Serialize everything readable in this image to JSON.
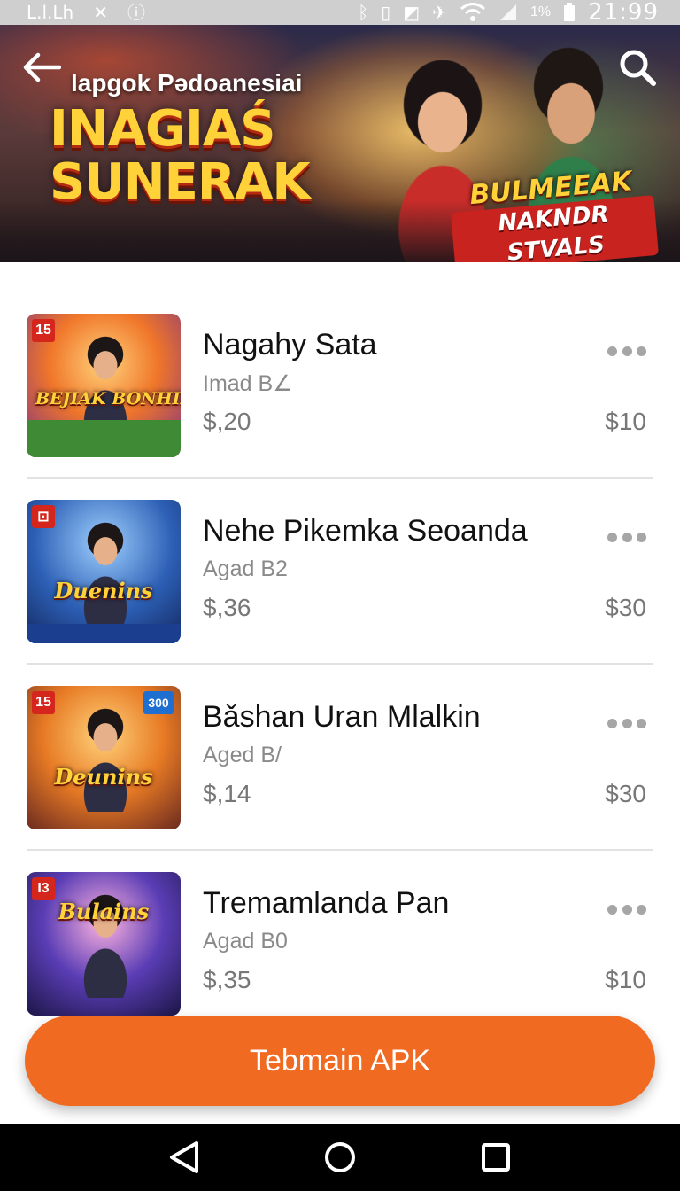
{
  "status_bar": {
    "carrier": "L.l.Lh",
    "battery_percent": "1%",
    "time": "21:99",
    "icons": [
      "close-icon",
      "info-icon",
      "bluetooth-icon",
      "vibrate-icon",
      "image-icon",
      "airplane-icon",
      "wifi-icon",
      "signal-icon",
      "battery-icon"
    ]
  },
  "banner": {
    "subtitle": "lapgok Pədoanesiai",
    "title_line1": "INAGIAŚ",
    "title_line2": "SUNERAK",
    "badge_line1": "BULMEEAK",
    "badge_line2": "NAKNDR STVALS",
    "back_icon": "arrow-left-icon",
    "search_icon": "search-icon"
  },
  "games": [
    {
      "title": "Nagahy Sata",
      "subtitle": "Imad B∠",
      "price": "$,20",
      "price_right": "$10",
      "thumb_text": "BEJIAK BONHIRES",
      "age_badge": "15",
      "corner_badge": ""
    },
    {
      "title": "Nehe Pikemka Seoanda",
      "subtitle": "Agad B2",
      "price": "$,36",
      "price_right": "$30",
      "thumb_text": "Duenins",
      "age_badge": "⊡",
      "corner_badge": ""
    },
    {
      "title": "Bǎshan Uran Mlalkin",
      "subtitle": "Aged B/",
      "price": "$,14",
      "price_right": "$30",
      "thumb_text": "Deunins",
      "age_badge": "15",
      "corner_badge": "300"
    },
    {
      "title": "Tremamlanda Pan",
      "subtitle": "Agad B0",
      "price": "$,35",
      "price_right": "$10",
      "thumb_text": "Bulains",
      "age_badge": "I3",
      "corner_badge": ""
    }
  ],
  "cta": {
    "label": "Tebmain APK",
    "color": "#f06a22"
  },
  "nav_bar": {
    "icons": [
      "back-triangle-icon",
      "home-circle-icon",
      "recents-square-icon"
    ]
  }
}
